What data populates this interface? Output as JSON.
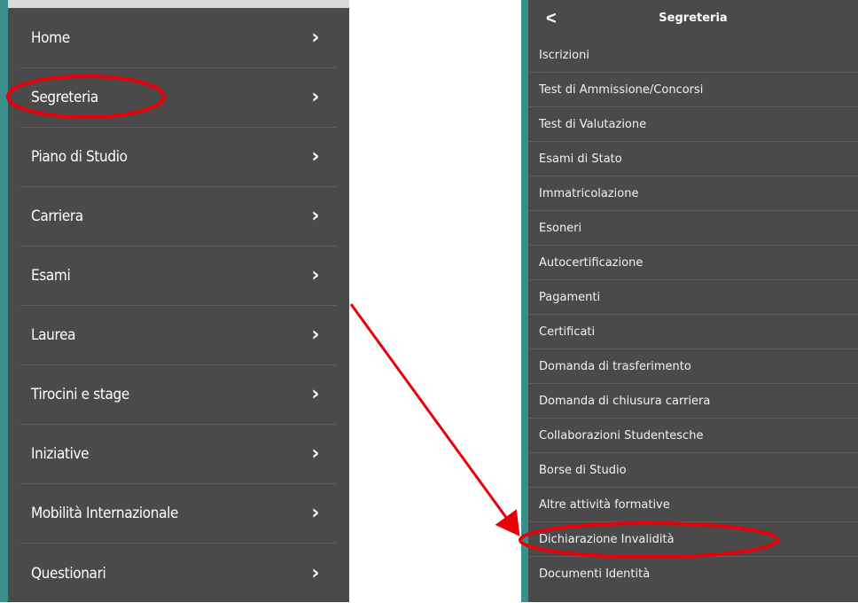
{
  "left_menu": {
    "items": [
      {
        "label": "Home"
      },
      {
        "label": "Segreteria"
      },
      {
        "label": "Piano di Studio"
      },
      {
        "label": "Carriera"
      },
      {
        "label": "Esami"
      },
      {
        "label": "Laurea"
      },
      {
        "label": "Tirocini e stage"
      },
      {
        "label": "Iniziative"
      },
      {
        "label": "Mobilità Internazionale"
      },
      {
        "label": "Questionari"
      }
    ],
    "chevron": "›",
    "chevron_icon": "chevron-right-icon"
  },
  "right_menu": {
    "back_glyph": "<",
    "back_icon": "chevron-left-icon",
    "title": "Segreteria",
    "items": [
      {
        "label": "Iscrizioni"
      },
      {
        "label": "Test di Ammissione/Concorsi"
      },
      {
        "label": "Test di Valutazione"
      },
      {
        "label": "Esami di Stato"
      },
      {
        "label": "Immatricolazione"
      },
      {
        "label": "Esoneri"
      },
      {
        "label": "Autocertificazione"
      },
      {
        "label": "Pagamenti"
      },
      {
        "label": "Certificati"
      },
      {
        "label": "Domanda di trasferimento"
      },
      {
        "label": "Domanda di chiusura carriera"
      },
      {
        "label": "Collaborazioni Studentesche"
      },
      {
        "label": "Borse di Studio"
      },
      {
        "label": "Altre attività formative"
      },
      {
        "label": "Dichiarazione Invalidità"
      },
      {
        "label": "Documenti Identità"
      }
    ]
  },
  "colors": {
    "menu_bg": "#4a4a4a",
    "accent": "#3a8f8a",
    "annotation": "#e8000a"
  }
}
